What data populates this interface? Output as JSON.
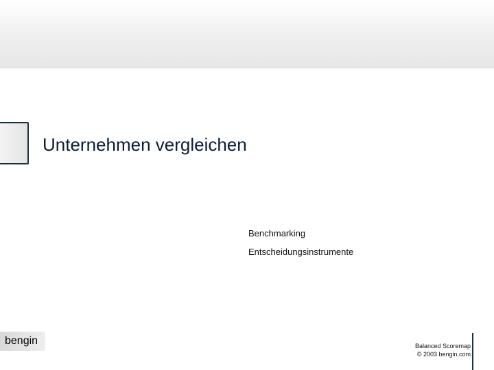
{
  "slide": {
    "title": "Unternehmen vergleichen",
    "subtitles": [
      "Benchmarking",
      "Entscheidungsinstrumente"
    ]
  },
  "brand": {
    "logo_text": "bengin"
  },
  "footer": {
    "line1": "Balanced Scoremap",
    "line2": "© 2003 bengin.com"
  },
  "colors": {
    "title": "#0d1e33",
    "accent_border": "#1f2f3f",
    "top_band_bottom": "#e6e6e6"
  }
}
